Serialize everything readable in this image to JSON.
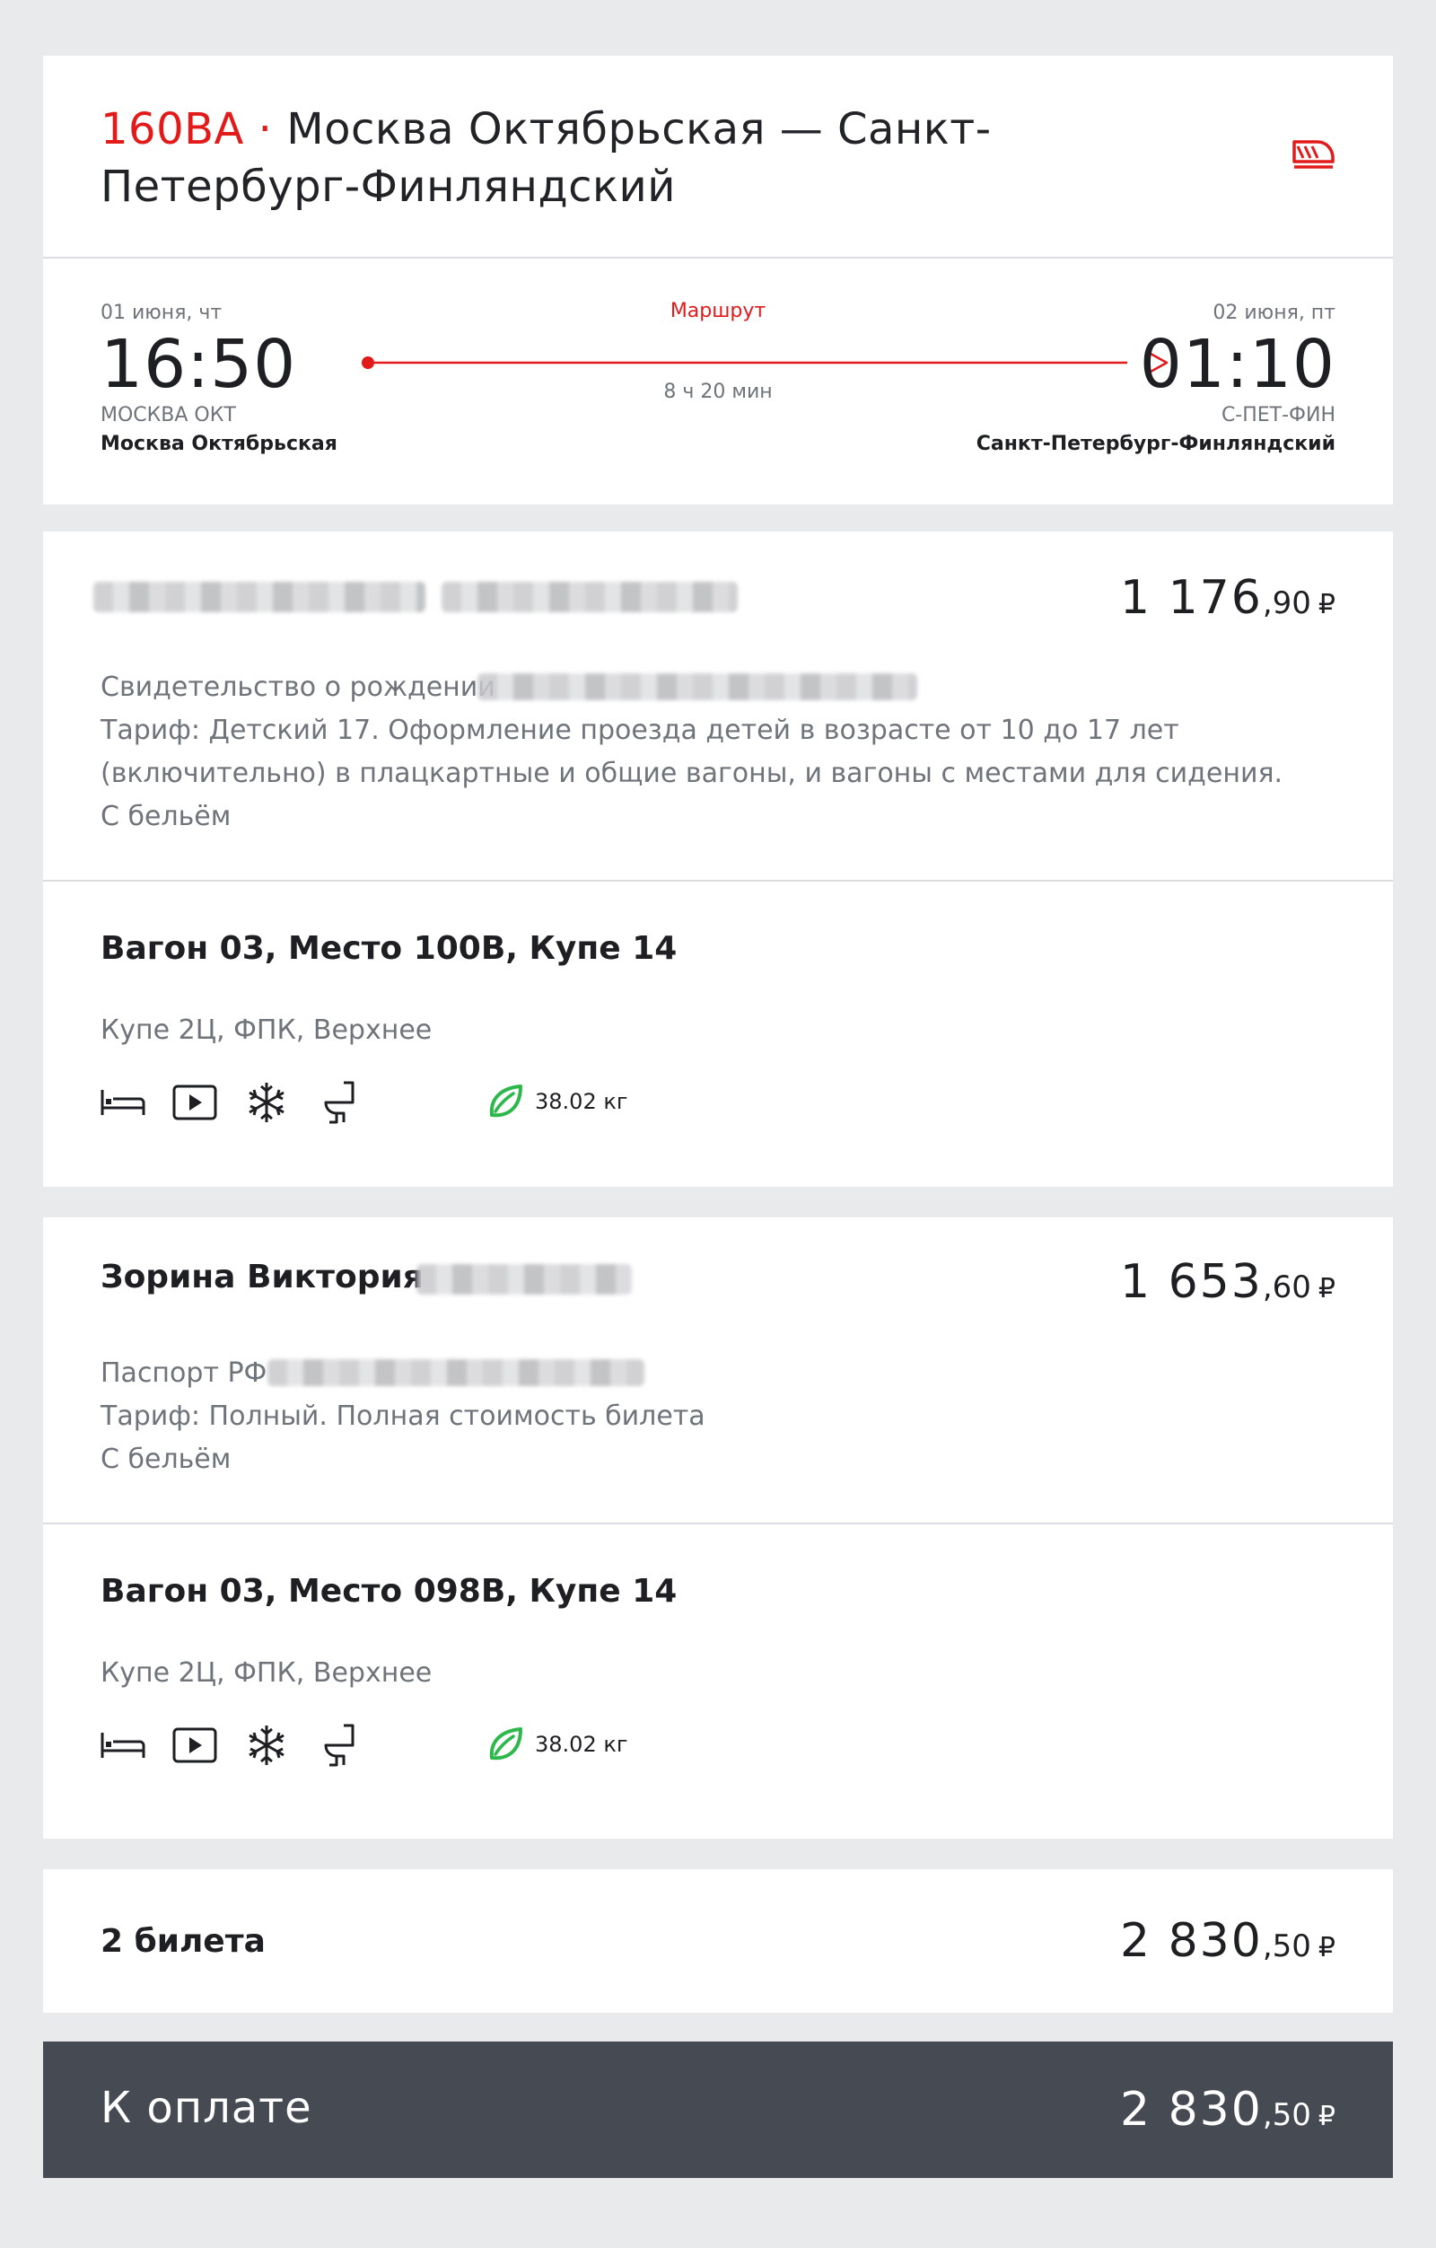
{
  "header": {
    "train_number": "160ВА",
    "separator": "·",
    "route_title": "Москва Октябрьская — Санкт-Петербург-Финляндский",
    "icon": "train-icon"
  },
  "departure": {
    "date": "01 июня, чт",
    "time": "16:50",
    "code": "МОСКВА ОКТ",
    "station": "Москва Октябрьская"
  },
  "arrival": {
    "date": "02 июня, пт",
    "time": "01:10",
    "code": "С-ПЕТ-ФИН",
    "station": "Санкт-Петербург-Финляндский"
  },
  "route": {
    "label": "Маршрут",
    "duration": "8 ч 20 мин"
  },
  "passengers": [
    {
      "name": "",
      "price_main": "1 176",
      "price_kop": ",90",
      "document": "Свидетельство о рождении",
      "tariff": "Тариф: Детский 17. Оформление проезда детей в возрасте от 10 до 17 лет (включительно) в плацкартные и общие вагоны, и вагоны с местами для сидения.",
      "linen": "С бельём",
      "seat": "Вагон 03, Место 100В, Купе 14",
      "car_type": "Купе 2Ц, ФПК, Верхнее",
      "amenities": [
        "bed-icon",
        "video-icon",
        "air-conditioning-icon",
        "toilet-icon"
      ],
      "eco": "38.02 кг"
    },
    {
      "name": "Зорина Виктория",
      "price_main": "1 653",
      "price_kop": ",60",
      "document": "Паспорт РФ",
      "tariff": "Тариф: Полный. Полная стоимость билета",
      "linen": "С бельём",
      "seat": "Вагон 03, Место 098В, Купе 14",
      "car_type": "Купе 2Ц, ФПК, Верхнее",
      "amenities": [
        "bed-icon",
        "video-icon",
        "air-conditioning-icon",
        "toilet-icon"
      ],
      "eco": "38.02 кг"
    }
  ],
  "total": {
    "label": "2 билета",
    "price_main": "2 830",
    "price_kop": ",50"
  },
  "payment": {
    "label": "К оплате",
    "price_main": "2 830",
    "price_kop": ",50"
  },
  "currency": "₽",
  "colors": {
    "accent": "#e21a1a",
    "muted": "#6f737a",
    "pay_bar": "#464a52",
    "eco_green": "#2db84b"
  }
}
